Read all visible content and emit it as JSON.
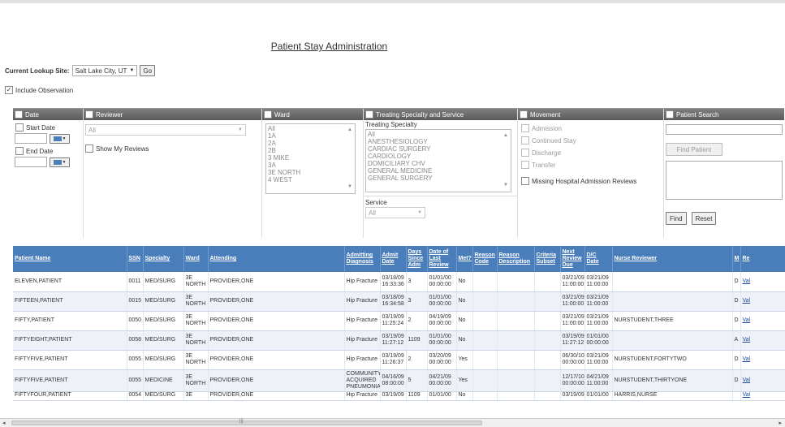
{
  "page": {
    "title": "Patient Stay Administration"
  },
  "lookup": {
    "label": "Current Lookup Site:",
    "site": "Salt Lake City, UT",
    "go_label": "Go"
  },
  "observation": {
    "label": "Include Observation",
    "checked": true
  },
  "filters": {
    "date": {
      "header": "Date",
      "start_label": "Start Date",
      "end_label": "End Date"
    },
    "reviewer": {
      "header": "Reviewer",
      "selected": "All",
      "show_my_reviews": "Show My Reviews"
    },
    "ward": {
      "header": "Ward",
      "options": [
        "All",
        "1A",
        "2A",
        "2B",
        "3 MIKE",
        "3A",
        "3E NORTH",
        "4 WEST"
      ]
    },
    "specialty": {
      "header": "Treating Specialty and Service",
      "specialty_label": "Treating Specialty",
      "options": [
        "All",
        "ANESTHESIOLOGY",
        "CARDIAC SURGERY",
        "CARDIOLOGY",
        "DOMICILIARY CHV",
        "GENERAL MEDICINE",
        "GENERAL SURGERY"
      ],
      "service_label": "Service",
      "service_selected": "All"
    },
    "movement": {
      "header": "Movement",
      "options": [
        "Admission",
        "Continued Stay",
        "Discharge",
        "Transfer"
      ],
      "missing_label": "Missing Hospital Admission Reviews"
    },
    "patient_search": {
      "header": "Patient Search",
      "find_patient_label": "Find Patient",
      "find_label": "Find",
      "reset_label": "Reset"
    }
  },
  "table": {
    "columns": [
      "Patient Name",
      "SSN",
      "Specialty",
      "Ward",
      "Attending",
      "Admitting Diagnosis",
      "Admit Date",
      "Days Since Adm",
      "Date of Last Review",
      "Met?",
      "Reason Code",
      "Reason Description",
      "Criteria Subset",
      "Next Review Due",
      "D/C Date",
      "Nurse Reviewer",
      "M",
      "Re"
    ],
    "rows": [
      [
        "ELEVEN,PATIENT",
        "0011",
        "MED/SURG",
        "3E NORTH",
        "PROVIDER,ONE",
        "Hip Fracture",
        "03/18/09 16:33:36",
        "3",
        "01/01/00 00:00:00",
        "No",
        "",
        "",
        "",
        "03/21/09 11:00:00",
        "03/21/09 11:00:00",
        "",
        "D",
        "Val"
      ],
      [
        "FIFTEEN,PATIENT",
        "0015",
        "MED/SURG",
        "3E NORTH",
        "PROVIDER,ONE",
        "Hip Fracture",
        "03/18/09 16:34:58",
        "3",
        "01/01/00 00:00:00",
        "No",
        "",
        "",
        "",
        "03/21/09 11:00:00",
        "03/21/09 11:00:00",
        "",
        "D",
        "Val"
      ],
      [
        "FIFTY,PATIENT",
        "0050",
        "MED/SURG",
        "3E NORTH",
        "PROVIDER,ONE",
        "Hip Fracture",
        "03/19/09 11:25:24",
        "2",
        "04/19/09 00:00:00",
        "No",
        "",
        "",
        "",
        "03/21/09 11:00:00",
        "03/21/09 11:00:00",
        "NURSTUDENT,THREE",
        "D",
        "Val"
      ],
      [
        "FIFTYEIGHT,PATIENT",
        "0058",
        "MED/SURG",
        "3E NORTH",
        "PROVIDER,ONE",
        "Hip Fracture",
        "03/19/09 11:27:12",
        "1109",
        "01/01/00 00:00:00",
        "No",
        "",
        "",
        "",
        "03/19/09 11:27:12",
        "01/01/00 00:00:00",
        "",
        "A",
        "Val"
      ],
      [
        "FIFTYFIVE,PATIENT",
        "0055",
        "MED/SURG",
        "3E NORTH",
        "PROVIDER,ONE",
        "Hip Fracture",
        "03/19/09 11:26:37",
        "2",
        "03/20/09 00:00:00",
        "Yes",
        "",
        "",
        "",
        "06/30/10 00:00:00",
        "03/21/09 11:00:00",
        "NURSTUDENT,FORTYTWO",
        "D",
        "Val"
      ],
      [
        "FIFTYFIVE,PATIENT",
        "0055",
        "MEDICINE",
        "3E NORTH",
        "PROVIDER,ONE",
        "COMMUNITY ACQUIRED PNEUMONIA",
        "04/16/09 08:00:00",
        "5",
        "04/21/09 00:00:00",
        "Yes",
        "",
        "",
        "",
        "12/17/10 00:00:00",
        "04/21/09 11:00:00",
        "NURSTUDENT,THIRTYONE",
        "D",
        "Val"
      ],
      [
        "FIFTYFOUR,PATIENT",
        "0054",
        "MED/SURG",
        "3E",
        "PROVIDER,ONE",
        "Hip Fracture",
        "03/19/09",
        "1109",
        "01/01/00",
        "No",
        "",
        "",
        "",
        "03/19/09",
        "01/01/00",
        "HARRIS,NURSE",
        "",
        "Val"
      ]
    ]
  },
  "colors": {
    "header_blue": "#4a7ebb",
    "panel_header": "#6a6a6a"
  }
}
